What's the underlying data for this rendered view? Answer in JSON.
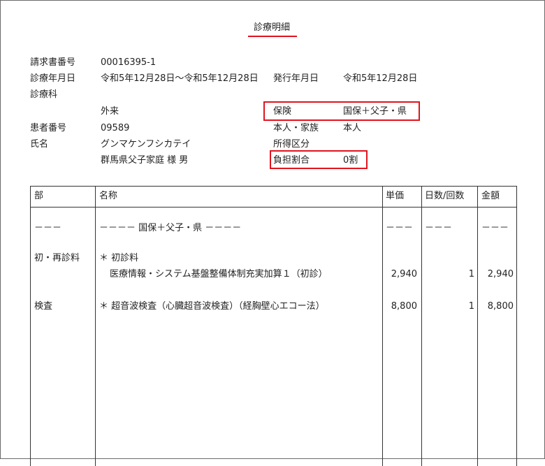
{
  "document": {
    "title": "診療明細",
    "fields": {
      "claim_no_label": "請求書番号",
      "claim_no": "00016395-1",
      "period_label": "診療年月日",
      "period": "令和5年12月28日～令和5年12月28日",
      "issued_label": "発行年月日",
      "issued": "令和5年12月28日",
      "department_label": "診療科",
      "department": "外来",
      "insurance_label": "保険",
      "insurance": "国保＋父子・県",
      "patient_no_label": "患者番号",
      "patient_no": "09589",
      "relation_label": "本人・家族",
      "relation": "本人",
      "name_label": "氏名",
      "name_kana": "グンマケンフシカテイ",
      "name": "群馬県父子家庭 様 男",
      "income_label": "所得区分",
      "burden_label": "負担割合",
      "burden": "0割"
    },
    "table": {
      "headers": [
        "部",
        "名称",
        "単価",
        "日数/回数",
        "金額"
      ],
      "dash_row": {
        "section": "－－－",
        "name": "－－－－ 国保＋父子・県 －－－－",
        "price": "－－－",
        "count": "－－－",
        "amount": "－－－"
      },
      "rows": [
        {
          "section": "初・再診料",
          "name": "＊ 初診料",
          "price": "",
          "count": "",
          "amount": ""
        },
        {
          "section": "",
          "name": "医療情報・システム基盤整備体制充実加算１（初診）",
          "price": "2,940",
          "count": "1",
          "amount": "2,940"
        },
        {
          "section": "検査",
          "name": "＊ 超音波検査（心臓超音波検査）（経胸壁心エコー法）",
          "price": "8,800",
          "count": "1",
          "amount": "8,800"
        }
      ]
    },
    "colors": {
      "highlight": "#e0141e",
      "border": "#333333",
      "text": "#222222"
    }
  }
}
